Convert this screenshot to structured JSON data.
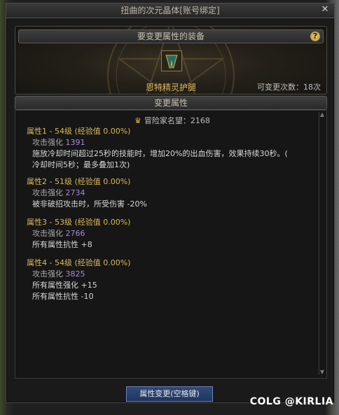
{
  "window": {
    "title": "扭曲的次元晶体[账号绑定]"
  },
  "equip_section": {
    "header": "要变更属性的装备",
    "item_name": "恩特精灵护腿",
    "change_count": "可变更次数：18次"
  },
  "attr_section": {
    "header": "变更属性",
    "fame": "冒险家名望：2168",
    "groups": [
      {
        "title": "属性1 - 54级 (经验值 0.00%)",
        "stat_label": "攻击强化",
        "stat_value": "1391",
        "desc": [
          "施放冷却时间超过25秒的技能时，增加20%的出血伤害，效果持续30秒。(",
          "冷却时间5秒；最多叠加1次)"
        ]
      },
      {
        "title": "属性2 - 51级 (经验值 0.00%)",
        "stat_label": "攻击强化",
        "stat_value": "2734",
        "desc": [
          "被非破招攻击时，所受伤害 -20%"
        ]
      },
      {
        "title": "属性3 - 53级 (经验值 0.00%)",
        "stat_label": "攻击强化",
        "stat_value": "2766",
        "desc": [
          "所有属性抗性 +8"
        ]
      },
      {
        "title": "属性4 - 54级 (经验值 0.00%)",
        "stat_label": "攻击强化",
        "stat_value": "3825",
        "desc": [
          "所有属性强化 +15",
          "所有属性抗性 -10"
        ]
      }
    ]
  },
  "action_button": "属性变更(空格键)",
  "watermark": "COLG @KIRLIA",
  "icons": {
    "close": "close-icon",
    "help": "help-icon",
    "fame": "crown-icon",
    "item": "leg-armor-icon"
  },
  "colors": {
    "gold_text": "#d9b75b",
    "stat_number": "#a58bd6",
    "button": "#2f4b7a"
  }
}
